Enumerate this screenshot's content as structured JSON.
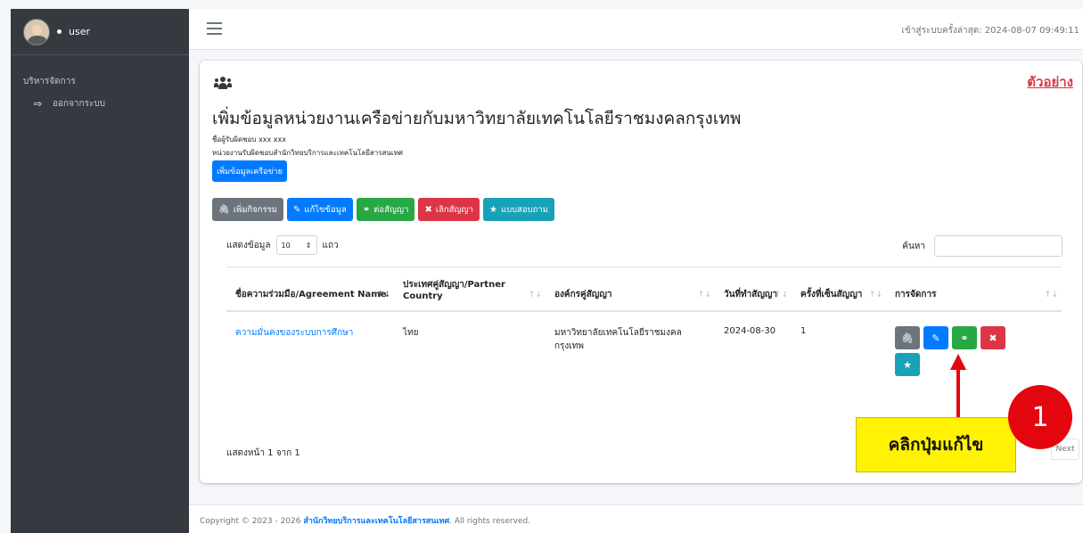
{
  "sidebar": {
    "username": "user",
    "menu_header": "บริหารจัดการ",
    "items": [
      {
        "label": "ออกจากระบบ",
        "icon": "sign-out-icon"
      }
    ]
  },
  "topbar": {
    "last_login": "เข้าสู่ระบบครั้งล่าสุด: 2024-08-07 09:49:11"
  },
  "card": {
    "example_label": "ตัวอย่าง",
    "title": "เพิ่มข้อมูลหน่วยงานเครือข่ายกับมหาวิทยาลัยเทคโนโลยีราชมงคลกรุงเทพ",
    "responsible_person": "ชื่อผู้รับผิดชอบ xxx xxx",
    "responsible_unit": "หน่วยงานรับผิดชอบสำนักวิทยบริการและเทคโนโลยีสารสนเทศ",
    "add_network_label": "เพิ่มข้อมูลเครือข่าย",
    "actions": [
      {
        "label": "เพิ่มกิจกรรม",
        "icon": "paperclip-icon",
        "color": "#6c757d"
      },
      {
        "label": "แก้ไขข้อมูล",
        "icon": "edit-icon",
        "color": "#007bff"
      },
      {
        "label": "ต่อสัญญา",
        "icon": "handshake-icon",
        "color": "#28a745"
      },
      {
        "label": "เลิกสัญญา",
        "icon": "user-times-icon",
        "color": "#dc3545"
      },
      {
        "label": "แบบสอบถาม",
        "icon": "star-icon",
        "color": "#17a2b8"
      }
    ]
  },
  "table": {
    "length_prefix": "แสดงข้อมูล",
    "length_value": "10",
    "length_suffix": "แถว",
    "search_label": "ค้นหา",
    "headers": [
      "ชื่อความร่วมมือ/Agreement Name",
      "ประเทศคู่สัญญา/Partner Country",
      "องค์กรคู่สัญญา",
      "วันที่ทำสัญญา",
      "ครั้งที่เซ็นสัญญา",
      "การจัดการ"
    ],
    "rows": [
      {
        "name": "ความมั่นคงของระบบการศึกษา",
        "country": "ไทย",
        "org": "มหาวิทยาลัยเทคโนโลยีราชมงคลกรุงเทพ",
        "date": "2024-08-30",
        "count": "1"
      }
    ],
    "info": "แสดงหน้า 1 จาก 1",
    "next_label": "Next"
  },
  "annotation": {
    "number": "1",
    "callout": "คลิกปุ่มแก้ไข",
    "color": "#e4060f"
  },
  "footer": {
    "prefix": "Copyright © 2023 - 2026 ",
    "org": "สำนักวิทยบริการและเทคโนโลยีสารสนเทศ",
    "suffix": ". All rights reserved."
  }
}
